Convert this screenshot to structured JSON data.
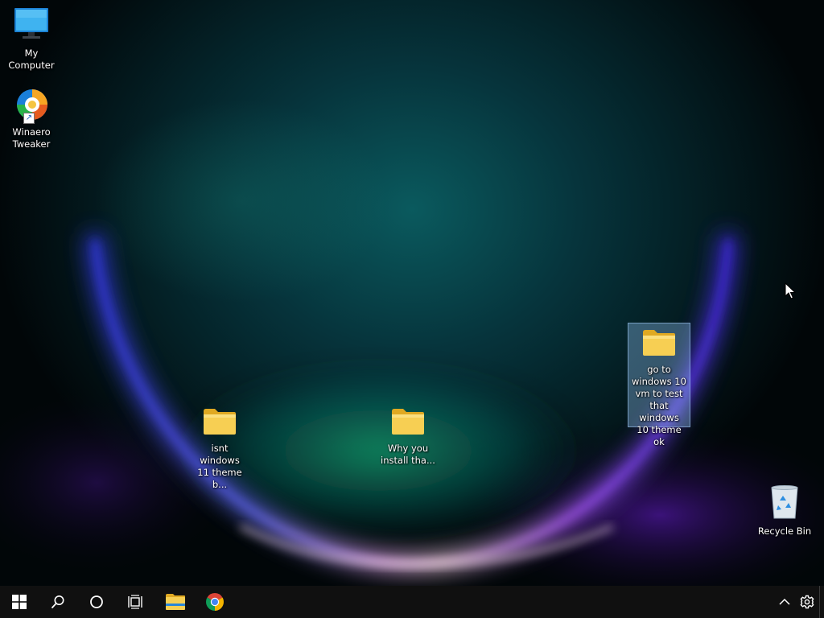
{
  "desktop": {
    "wallpaper_accent": "#1ea8b0",
    "icons": [
      {
        "name": "my-computer",
        "label": "My Computer",
        "icon": "monitor-icon"
      },
      {
        "name": "winaero-tweaker",
        "label": "Winaero\nTweaker",
        "icon": "winaero-tweaker-icon",
        "shortcut": true
      },
      {
        "name": "folder-isnt-windows-11",
        "label": "isnt windows\n11 theme b...",
        "icon": "folder-icon"
      },
      {
        "name": "folder-why-you-install",
        "label": "Why you\ninstall tha...",
        "icon": "folder-icon"
      },
      {
        "name": "folder-go-to-windows-10",
        "label": "go to\nwindows 10\nvm to test\nthat windows\n10 theme ok",
        "icon": "folder-icon",
        "selected": true
      },
      {
        "name": "recycle-bin",
        "label": "Recycle Bin",
        "icon": "recycle-bin-icon"
      }
    ]
  },
  "taskbar": {
    "background": "#101010",
    "buttons": [
      {
        "name": "start-button",
        "icon": "windows-logo-icon"
      },
      {
        "name": "search-button",
        "icon": "search-icon"
      },
      {
        "name": "cortana-button",
        "icon": "cortana-circle-icon"
      },
      {
        "name": "task-view-button",
        "icon": "task-view-icon"
      },
      {
        "name": "file-explorer-button",
        "icon": "file-explorer-icon"
      },
      {
        "name": "chrome-button",
        "icon": "chrome-icon"
      }
    ],
    "tray": [
      {
        "name": "show-hidden-icons-button",
        "icon": "chevron-up-icon"
      },
      {
        "name": "settings-button",
        "icon": "gear-icon"
      }
    ]
  }
}
